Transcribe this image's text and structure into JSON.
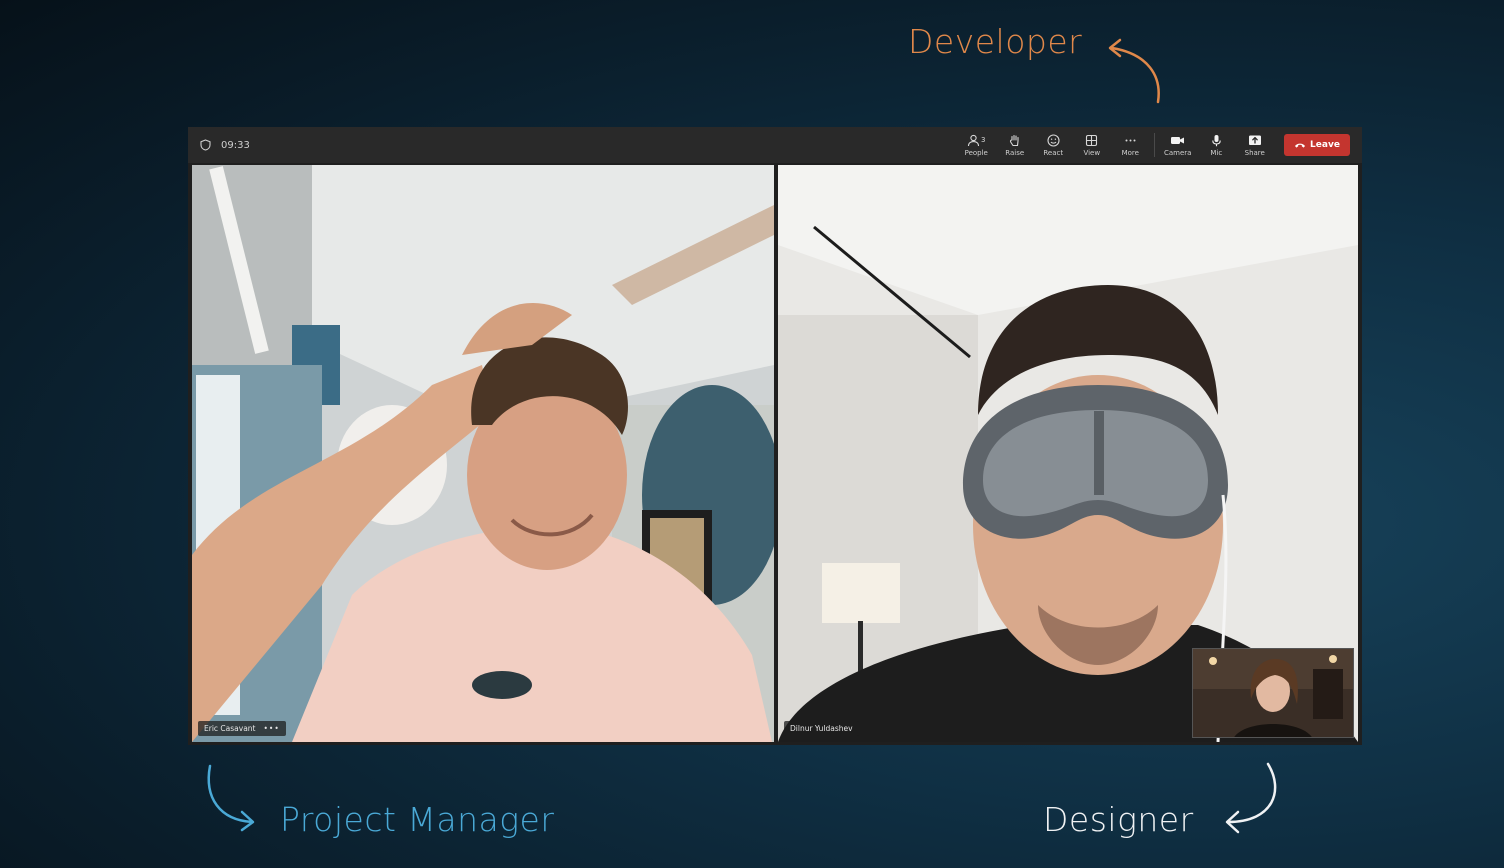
{
  "annotations": {
    "developer": "Developer",
    "project_manager": "Project Manager",
    "designer": "Designer"
  },
  "meeting": {
    "timer": "09:33",
    "toolbar": {
      "people_label": "People",
      "people_count": "3",
      "raise_label": "Raise",
      "react_label": "React",
      "view_label": "View",
      "more_label": "More",
      "camera_label": "Camera",
      "mic_label": "Mic",
      "share_label": "Share",
      "leave_label": "Leave"
    },
    "participants": [
      {
        "name": "Eric Casavant"
      },
      {
        "name": "Dilnur Yuldashev"
      }
    ]
  },
  "colors": {
    "developer_label": "#e0884a",
    "pm_label": "#4aa9d6",
    "designer_label": "#f0f2f4",
    "leave_button": "#c4352f",
    "active_speaker_outline": "#7b83eb"
  }
}
